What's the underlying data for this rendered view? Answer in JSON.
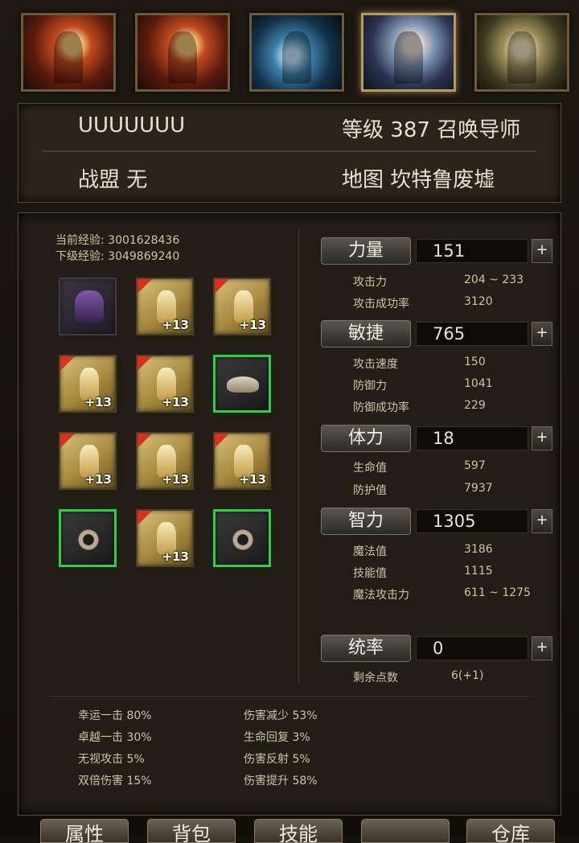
{
  "portraits": [
    {
      "icon": "warrior-red-portrait",
      "selected": false
    },
    {
      "icon": "warrior-red-portrait",
      "selected": false
    },
    {
      "icon": "lightning-knight-portrait",
      "selected": false
    },
    {
      "icon": "archer-portrait",
      "selected": true
    },
    {
      "icon": "gold-warrior-portrait",
      "selected": false
    }
  ],
  "character": {
    "name": "UUUUUUU",
    "level_label": "等级",
    "level": "387",
    "class": "召唤导师",
    "guild_label": "战盟",
    "guild": "无",
    "map_label": "地图",
    "map": "坎特鲁废墟"
  },
  "experience": {
    "current": "当前经验: 3001628436",
    "next": "下级经验: 3049869240"
  },
  "equipment": [
    {
      "icon": "dark-wings-icon",
      "enhance": ""
    },
    {
      "icon": "armor-helm-icon",
      "enhance": "+13"
    },
    {
      "icon": "armor-chest-icon",
      "enhance": "+13"
    },
    {
      "icon": "armor-gloves-icon",
      "enhance": "+13"
    },
    {
      "icon": "armor-body-icon",
      "enhance": "+13"
    },
    {
      "icon": "pet-icon",
      "enhance": ""
    },
    {
      "icon": "weapon-icon",
      "enhance": "+13"
    },
    {
      "icon": "armor-pants-icon",
      "enhance": "+13"
    },
    {
      "icon": "shield-icon",
      "enhance": "+13"
    },
    {
      "icon": "ring-icon",
      "enhance": ""
    },
    {
      "icon": "armor-boots-icon",
      "enhance": "+13"
    },
    {
      "icon": "ring-icon",
      "enhance": ""
    }
  ],
  "stats": {
    "strength": {
      "label": "力量",
      "value": "151",
      "plus": "+"
    },
    "agility": {
      "label": "敏捷",
      "value": "765",
      "plus": "+"
    },
    "vitality": {
      "label": "体力",
      "value": "18",
      "plus": "+"
    },
    "energy": {
      "label": "智力",
      "value": "1305",
      "plus": "+"
    },
    "command": {
      "label": "统率",
      "value": "0",
      "plus": "+"
    }
  },
  "substats": {
    "attack": {
      "label": "攻击力",
      "value": "204 ~ 233"
    },
    "attack_rate": {
      "label": "攻击成功率",
      "value": "3120"
    },
    "attack_speed": {
      "label": "攻击速度",
      "value": "150"
    },
    "defense": {
      "label": "防御力",
      "value": "1041"
    },
    "defense_rate": {
      "label": "防御成功率",
      "value": "229"
    },
    "hp": {
      "label": "生命值",
      "value": "597"
    },
    "protect": {
      "label": "防护值",
      "value": "7937"
    },
    "mana": {
      "label": "魔法值",
      "value": "3186"
    },
    "skill": {
      "label": "技能值",
      "value": "1115"
    },
    "magic_attack": {
      "label": "魔法攻击力",
      "value": "611 ~ 1275"
    },
    "remaining": {
      "label": "剩余点数",
      "value": "6(+1)"
    }
  },
  "bonuses": {
    "lucky": "幸运一击  80%",
    "excellent": "卓越一击  30%",
    "ignore": "无视攻击    5%",
    "double": "双倍伤害  15%",
    "reduce": "伤害减少  53%",
    "regen": "生命回复    3%",
    "reflect": "伤害反射    5%",
    "increase": "伤害提升  58%"
  },
  "tabs": {
    "attributes": "属性",
    "bag": "背包",
    "skills": "技能",
    "blank": "",
    "warehouse": "仓库"
  }
}
